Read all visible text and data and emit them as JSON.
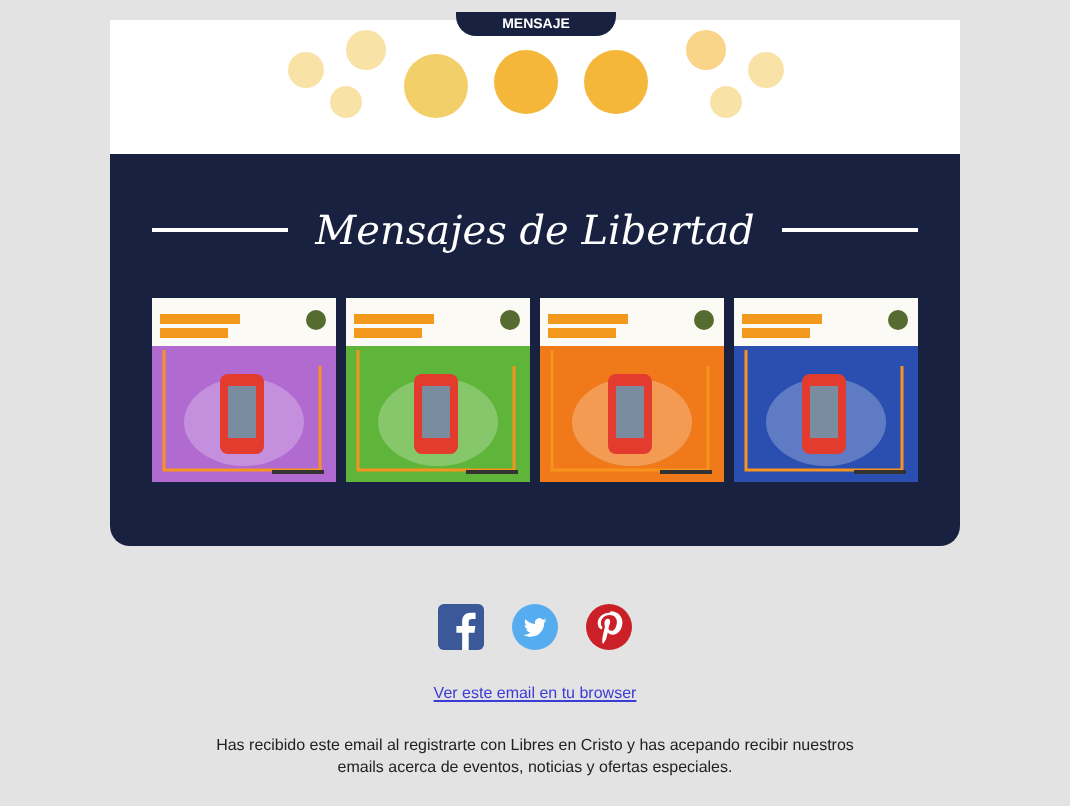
{
  "header": {
    "button": "MENSAJE"
  },
  "section": {
    "title": "Mensajes de Libertad"
  },
  "social": [
    {
      "kind": "facebook"
    },
    {
      "kind": "twitter"
    },
    {
      "kind": "pinterest"
    }
  ],
  "footer": {
    "link": "Ver este email en tu browser",
    "notice": "Has recibido este email al registrarte con Libres en Cristo y has acepando recibir nuestros emails acerca de eventos, noticias y ofertas especiales."
  }
}
